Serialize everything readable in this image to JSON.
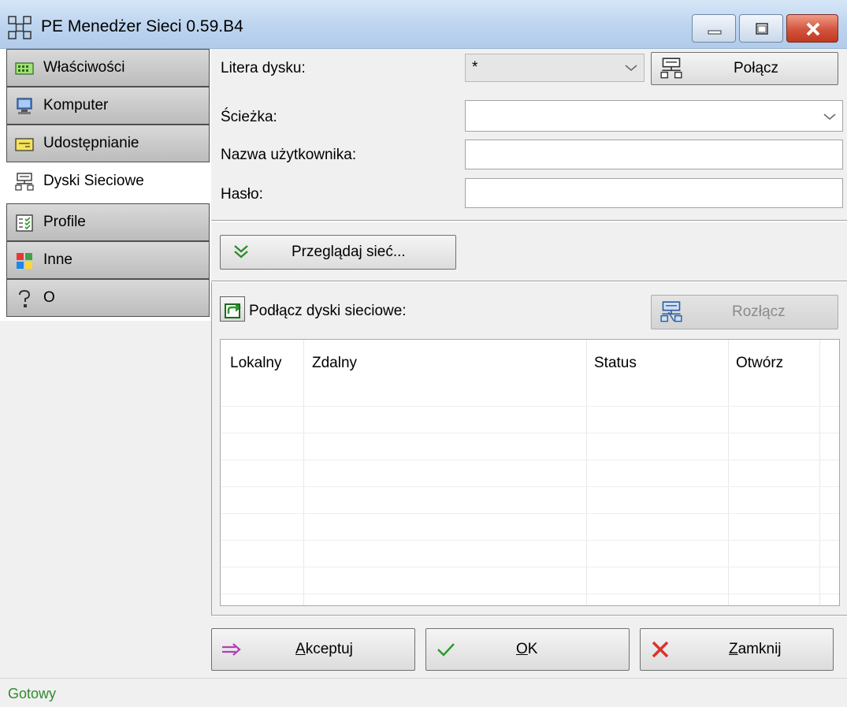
{
  "window": {
    "title": "PE Menedżer Sieci 0.59.B4"
  },
  "sidebar": {
    "items": [
      {
        "label": "Właściwości",
        "icon": "properties-icon"
      },
      {
        "label": "Komputer",
        "icon": "computer-icon"
      },
      {
        "label": "Udostępnianie",
        "icon": "share-icon"
      },
      {
        "label": "Dyski Sieciowe",
        "icon": "network-drive-icon",
        "active": true
      },
      {
        "label": "Profile",
        "icon": "profile-icon"
      },
      {
        "label": "Inne",
        "icon": "other-icon"
      },
      {
        "label": "O",
        "icon": "question-icon"
      }
    ]
  },
  "form": {
    "drive_letter_label": "Litera dysku:",
    "drive_letter_value": "*",
    "connect_button": "Połącz",
    "path_label": "Ścieżka:",
    "path_value": "",
    "username_label": "Nazwa użytkownika:",
    "username_value": "",
    "password_label": "Hasło:",
    "password_value": ""
  },
  "browse": {
    "button_label": "Przeglądaj sieć..."
  },
  "mapped": {
    "label": "Podłącz dyski sieciowe:",
    "disconnect_button": "Rozłącz",
    "columns": [
      "Lokalny",
      "Zdalny",
      "Status",
      "Otwórz"
    ],
    "rows": []
  },
  "footer": {
    "accept_prefix": "A",
    "accept_rest": "kceptuj",
    "ok_prefix": "O",
    "ok_rest": "K",
    "close_prefix": "Z",
    "close_rest": "amknij"
  },
  "status": {
    "text": "Gotowy"
  },
  "colors": {
    "status_text": "#2f8a2f",
    "close_button": "#c0391f",
    "accent_blue": "#3a6ea5"
  }
}
